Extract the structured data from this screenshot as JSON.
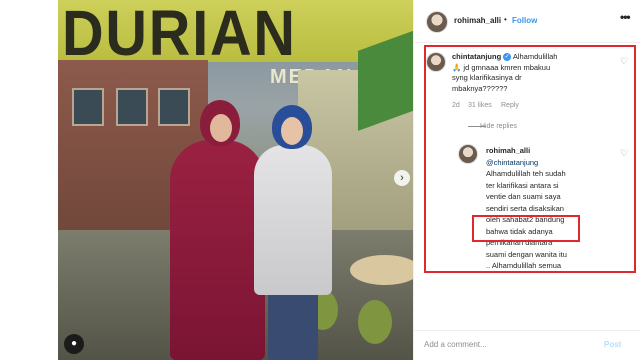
{
  "photo": {
    "sign_text": "DURIAN",
    "sign_subtext": "MEDAN",
    "next_glyph": "›"
  },
  "header": {
    "username": "rohimah_alli",
    "separator": "•",
    "follow_label": "Follow",
    "more_label": "•••"
  },
  "comments": [
    {
      "username": "chintatanjung",
      "verified": true,
      "text_line1": "Alhamdulillah",
      "text_line2": "🙏 jd gmnaaa kmren mbakuu",
      "text_line3": "syng klarifikasinya dr",
      "text_line4": "mbaknya??????",
      "age": "2d",
      "likes": "31 likes",
      "reply_label": "Reply",
      "hide_replies_label": "Hide replies"
    },
    {
      "username": "rohimah_alli",
      "text_lines": [
        "@chintatanjung",
        "Alhamdulillah teh sudah",
        "ter klarifikasi antara si",
        "ventie dan suami saya",
        "sendiri serta disaksikan",
        "oleh sahabat2 bandung",
        "bahwa tidak adanya",
        "pernikahan diantara",
        "suami dengan wanita itu",
        ".. Alhamdulillah semua"
      ]
    }
  ],
  "footer": {
    "placeholder": "Add a comment...",
    "post_label": "Post"
  },
  "colors": {
    "accent": "#3897f0",
    "highlight_box": "#e0292d",
    "muted_text": "#8e8e8e"
  }
}
